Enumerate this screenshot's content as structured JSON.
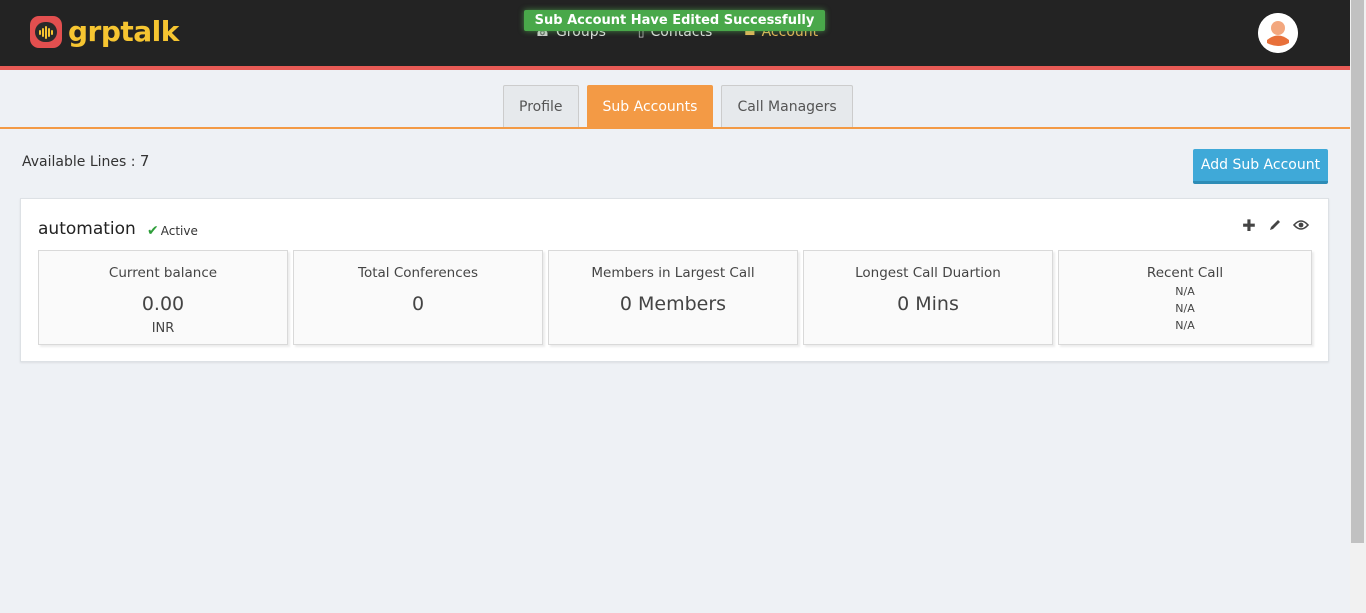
{
  "app": {
    "logo_text": "grptalk"
  },
  "header": {
    "nav": [
      {
        "label": "Groups",
        "icon": "phone-icon"
      },
      {
        "label": "Contacts",
        "icon": "contacts-icon"
      },
      {
        "label": "Account",
        "icon": "account-icon"
      }
    ],
    "toast": "Sub Account Have Edited Successfully"
  },
  "tabs": [
    {
      "label": "Profile",
      "active": false
    },
    {
      "label": "Sub Accounts",
      "active": true
    },
    {
      "label": "Call Managers",
      "active": false
    }
  ],
  "available_lines": {
    "label": "Available Lines",
    "sep": ":",
    "value": "7"
  },
  "add_button": "Add Sub Account",
  "account": {
    "name": "automation",
    "status": "Active",
    "stats": {
      "balance": {
        "title": "Current balance",
        "value": "0.00",
        "unit": "INR"
      },
      "conferences": {
        "title": "Total Conferences",
        "value": "0"
      },
      "largest": {
        "title": "Members in Largest Call",
        "value": "0 Members"
      },
      "longest": {
        "title": "Longest Call Duartion",
        "value": "0 Mins"
      },
      "recent": {
        "title": "Recent Call",
        "lines": [
          "N/A",
          "N/A",
          "N/A"
        ]
      }
    }
  },
  "colors": {
    "accent": "#f39a45",
    "header": "#232323",
    "brand": "#f6c531",
    "button": "#3fa9d8",
    "toast": "#49a84a"
  }
}
